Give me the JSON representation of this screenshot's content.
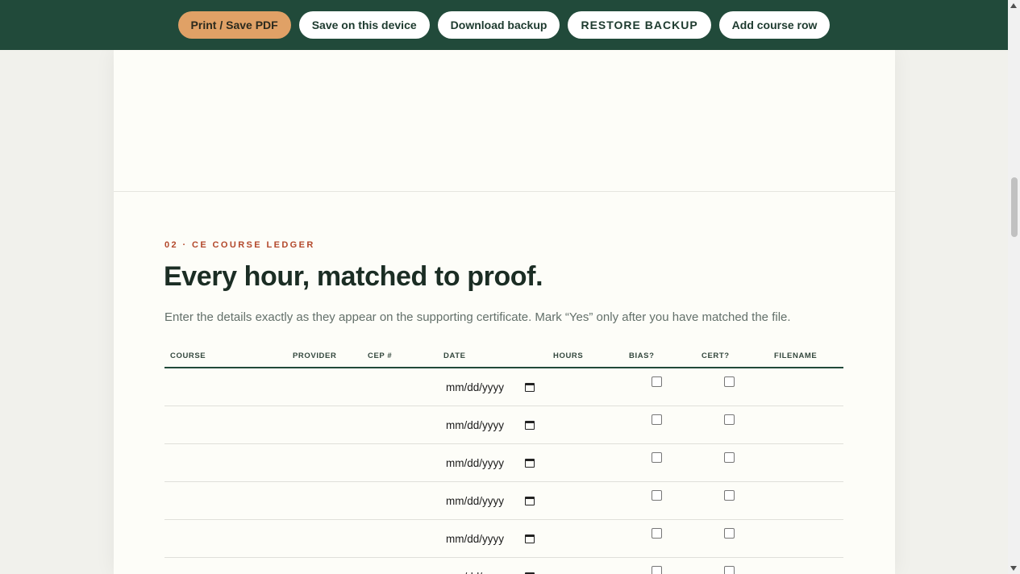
{
  "toolbar": {
    "print_label": "Print / Save PDF",
    "save_label": "Save on this device",
    "download_label": "Download backup",
    "restore_label": "RESTORE BACKUP",
    "add_row_label": "Add course row"
  },
  "section": {
    "eyebrow": "02 · CE COURSE LEDGER",
    "title": "Every hour, matched to proof.",
    "lead": "Enter the details exactly as they appear on the supporting certificate. Mark “Yes” only after you have matched the file."
  },
  "ledger": {
    "columns": [
      "COURSE",
      "PROVIDER",
      "CEP #",
      "DATE",
      "HOURS",
      "BIAS?",
      "CERT?",
      "FILENAME"
    ],
    "date_placeholder": "mm/dd/yyyy",
    "rows": [
      {
        "course": "",
        "provider": "",
        "cep": "",
        "date": "",
        "hours": "",
        "bias": false,
        "cert": false,
        "filename": ""
      },
      {
        "course": "",
        "provider": "",
        "cep": "",
        "date": "",
        "hours": "",
        "bias": false,
        "cert": false,
        "filename": ""
      },
      {
        "course": "",
        "provider": "",
        "cep": "",
        "date": "",
        "hours": "",
        "bias": false,
        "cert": false,
        "filename": ""
      },
      {
        "course": "",
        "provider": "",
        "cep": "",
        "date": "",
        "hours": "",
        "bias": false,
        "cert": false,
        "filename": ""
      },
      {
        "course": "",
        "provider": "",
        "cep": "",
        "date": "",
        "hours": "",
        "bias": false,
        "cert": false,
        "filename": ""
      },
      {
        "course": "",
        "provider": "",
        "cep": "",
        "date": "",
        "hours": "",
        "bias": false,
        "cert": false,
        "filename": ""
      }
    ]
  },
  "colors": {
    "toolbar_bg": "#214a3a",
    "primary_button": "#e0a166",
    "eyebrow": "#b3482b",
    "title": "#1b2d24",
    "page_bg": "#f1f1ec",
    "sheet_bg": "#fdfdf8"
  },
  "icons": {
    "date_picker": "calendar-icon"
  }
}
